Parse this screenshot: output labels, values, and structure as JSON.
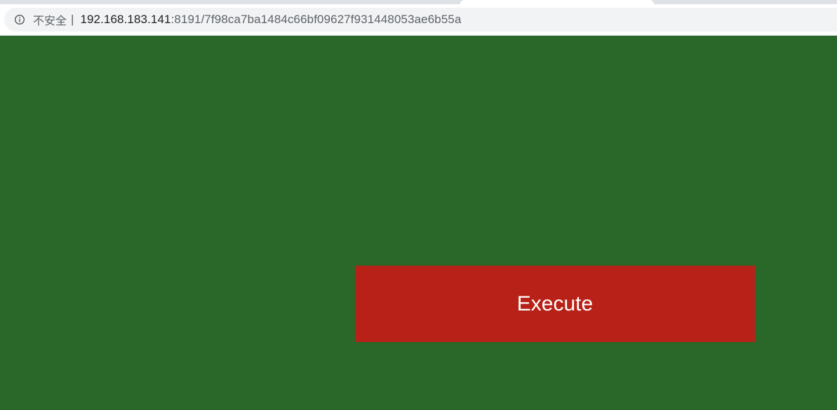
{
  "browser": {
    "security_label": "不安全",
    "separator": "|",
    "url_host": "192.168.183.141",
    "url_rest": ":8191/7f98ca7ba1484c66bf09627f931448053ae6b55a",
    "security_icon": "info-icon"
  },
  "page": {
    "background_color": "#2a6829",
    "execute_button_label": "Execute",
    "execute_button_color": "#b82117"
  }
}
